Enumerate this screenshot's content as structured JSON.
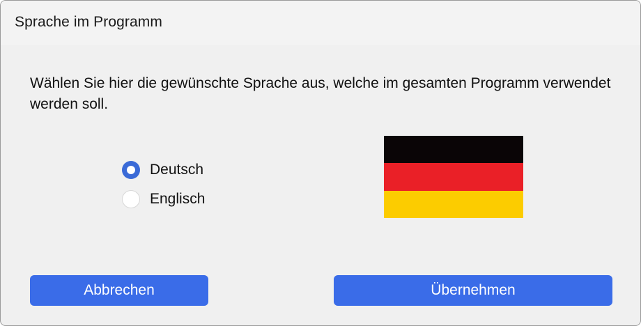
{
  "window": {
    "title": "Sprache im Programm"
  },
  "description": "Wählen Sie hier die gewünschte Sprache aus, welche im gesamten Programm verwendet werden soll.",
  "language_options": [
    {
      "label": "Deutsch",
      "selected": true
    },
    {
      "label": "Englisch",
      "selected": false
    }
  ],
  "flag": {
    "name": "german-flag",
    "stripe_colors": [
      "#0a0506",
      "#ea2027",
      "#fccc00"
    ]
  },
  "buttons": {
    "cancel_label": "Abbrechen",
    "apply_label": "Übernehmen"
  },
  "colors": {
    "accent": "#3a6ce8",
    "dialog_bg": "#f0f0f0"
  }
}
